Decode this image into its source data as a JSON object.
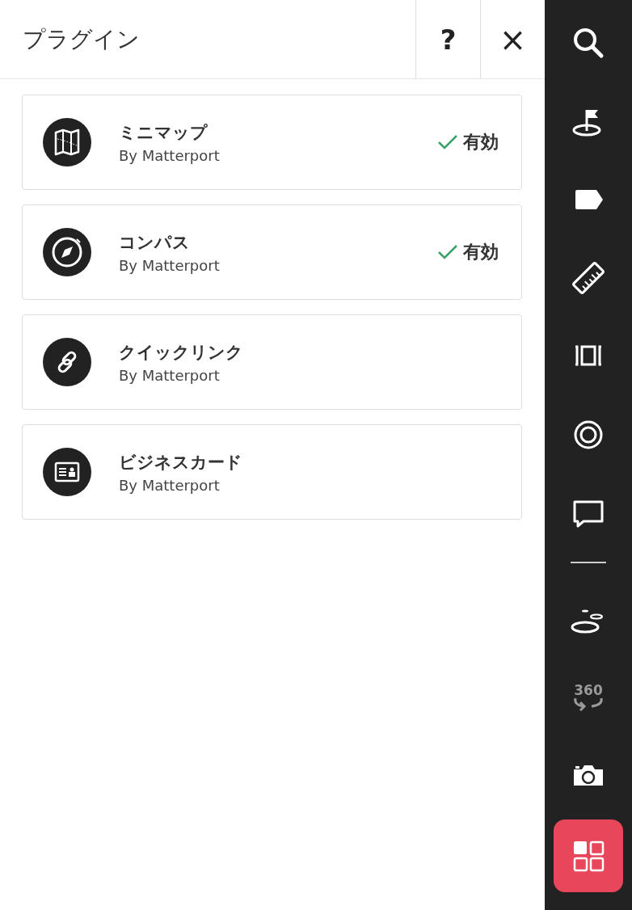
{
  "header": {
    "title": "プラグイン",
    "help_label": "?",
    "close_label": "×"
  },
  "plugins": [
    {
      "kind": "map",
      "name": "ミニマップ",
      "author": "By Matterport",
      "enabled": true,
      "status": "有効"
    },
    {
      "kind": "compass",
      "name": "コンパス",
      "author": "By Matterport",
      "enabled": true,
      "status": "有効"
    },
    {
      "kind": "link",
      "name": "クイックリンク",
      "author": "By Matterport",
      "enabled": false
    },
    {
      "kind": "card",
      "name": "ビジネスカード",
      "author": "By Matterport",
      "enabled": false
    }
  ],
  "toolbar": [
    {
      "kind": "search",
      "selected": false,
      "disabled": false
    },
    {
      "kind": "flag",
      "selected": false,
      "disabled": false
    },
    {
      "kind": "tag",
      "selected": false,
      "disabled": false
    },
    {
      "kind": "ruler",
      "selected": false,
      "disabled": false
    },
    {
      "kind": "floorplan",
      "selected": false,
      "disabled": false
    },
    {
      "kind": "target",
      "selected": false,
      "disabled": false
    },
    {
      "kind": "comment",
      "selected": false,
      "disabled": false
    },
    {
      "kind": "divider"
    },
    {
      "kind": "pucks",
      "selected": false,
      "disabled": false
    },
    {
      "kind": "pano",
      "label": "360",
      "selected": false,
      "disabled": true
    },
    {
      "kind": "camera",
      "selected": false,
      "disabled": false
    },
    {
      "kind": "plugins",
      "selected": true,
      "disabled": false
    }
  ]
}
